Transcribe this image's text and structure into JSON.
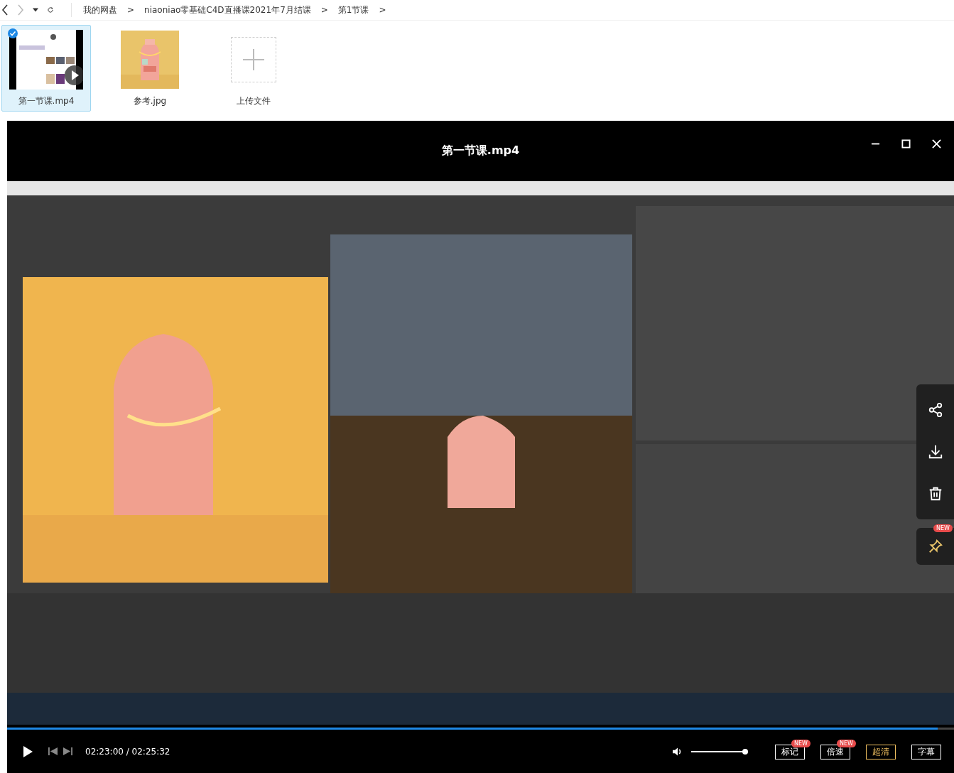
{
  "nav": {
    "breadcrumb": [
      "我的网盘",
      "niaoniao零基础C4D直播课2021年7月结课",
      "第1节课"
    ],
    "separator": ">"
  },
  "files": [
    {
      "kind": "video",
      "name": "第一节课.mp4",
      "selected": true
    },
    {
      "name": "参考.jpg",
      "selected": false
    },
    {
      "kind": "upload",
      "name": "上传文件",
      "selected": false
    }
  ],
  "player": {
    "title": "第一节课.mp4",
    "progress": {
      "level": 0.983
    },
    "time": "02:23:00 / 02:25:32",
    "volume": {
      "level": 1.0
    },
    "buttons": [
      {
        "label": "标记",
        "badge": "NEW",
        "highlighted": false
      },
      {
        "label": "倍速",
        "badge": "NEW",
        "highlighted": false
      },
      {
        "label": "超清",
        "highlighted": true
      },
      {
        "label": "字幕",
        "highlighted": false
      }
    ],
    "side_actions": [
      {
        "kind": "share"
      },
      {
        "kind": "download"
      },
      {
        "kind": "delete"
      }
    ],
    "pin": {
      "badge": "NEW"
    }
  }
}
